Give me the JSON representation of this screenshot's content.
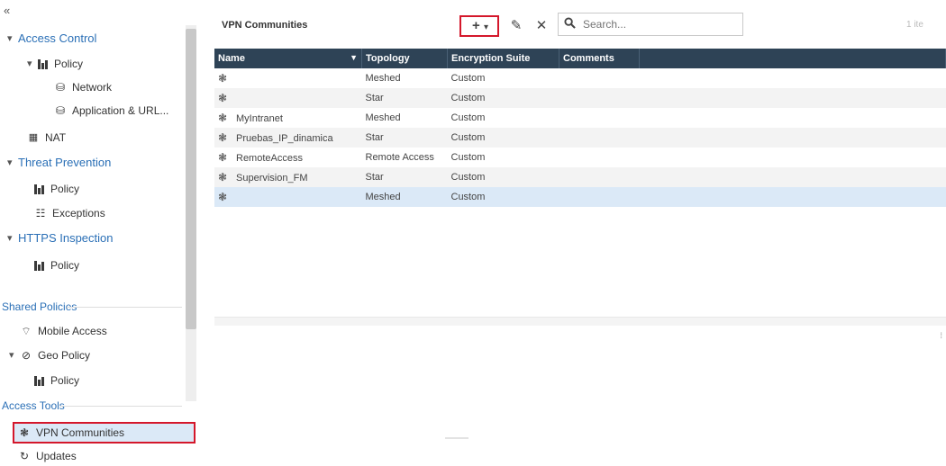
{
  "sidebar": {
    "collapse_glyph": "«",
    "access_control": "Access Control",
    "ac_policy": "Policy",
    "ac_network": "Network",
    "ac_app": "Application & URL...",
    "nat": "NAT",
    "threat_prevention": "Threat Prevention",
    "tp_policy": "Policy",
    "tp_exceptions": "Exceptions",
    "https_inspection": "HTTPS Inspection",
    "hi_policy": "Policy",
    "shared_policies": "Shared Policies",
    "mobile_access": "Mobile Access",
    "geo_policy": "Geo Policy",
    "geo_sub_policy": "Policy",
    "access_tools": "Access Tools",
    "vpn_communities": "VPN Communities",
    "updates": "Updates"
  },
  "toolbar": {
    "title": "VPN Communities",
    "add_glyph": "+",
    "add_caret": "▾",
    "edit_glyph": "✎",
    "delete_glyph": "✕",
    "search_placeholder": "Search...",
    "right_hint": "1 ite"
  },
  "table": {
    "columns": [
      "Name",
      "Topology",
      "Encryption Suite",
      "Comments"
    ],
    "rows": [
      {
        "name": "",
        "topology": "Meshed",
        "encryption": "Custom",
        "comments": ""
      },
      {
        "name": "",
        "topology": "Star",
        "encryption": "Custom",
        "comments": ""
      },
      {
        "name": "MyIntranet",
        "topology": "Meshed",
        "encryption": "Custom",
        "comments": ""
      },
      {
        "name": "Pruebas_IP_dinamica",
        "topology": "Star",
        "encryption": "Custom",
        "comments": ""
      },
      {
        "name": "RemoteAccess",
        "topology": "Remote Access",
        "encryption": "Custom",
        "comments": ""
      },
      {
        "name": "Supervision_FM",
        "topology": "Star",
        "encryption": "Custom",
        "comments": ""
      },
      {
        "name": "",
        "topology": "Meshed",
        "encryption": "Custom",
        "comments": ""
      }
    ]
  },
  "colors": {
    "header_bg": "#2e4356",
    "highlight_red": "#d4172b",
    "section_blue": "#2a6fb6",
    "selected_row": "#dbe9f7"
  }
}
